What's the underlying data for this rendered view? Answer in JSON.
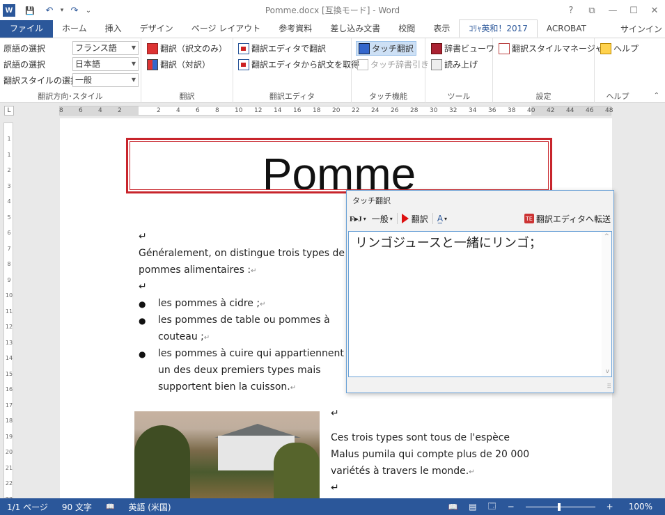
{
  "window": {
    "title": "Pomme.docx [互換モード] - Word",
    "signin": "サインイン",
    "ctl_help": "?",
    "ctl_restore_small": "⧉",
    "ctl_minimize": "—",
    "ctl_maximize": "☐",
    "ctl_close": "✕"
  },
  "qat": {
    "word_logo": "W",
    "save_glyph": "💾",
    "undo_glyph": "↶",
    "undo_dd": "▾",
    "redo_glyph": "↷",
    "customize": "⌄"
  },
  "tabs": [
    "ファイル",
    "ホーム",
    "挿入",
    "デザイン",
    "ページ レイアウト",
    "参考資料",
    "差し込み文書",
    "校閲",
    "表示",
    "ｺﾘｬ英和！2017",
    "ACROBAT"
  ],
  "ribbon": {
    "direction": {
      "src_label": "原語の選択",
      "src_value": "フランス語",
      "dst_label": "訳語の選択",
      "dst_value": "日本語",
      "style_label": "翻訳スタイルの選択",
      "style_value": "一般",
      "group": "翻訳方向･スタイル"
    },
    "translate": {
      "only": "翻訳（訳文のみ）",
      "paired": "翻訳（対訳）",
      "group": "翻訳"
    },
    "editor": {
      "open": "翻訳エディタで翻訳",
      "fetch": "翻訳エディタから訳文を取得",
      "group": "翻訳エディタ"
    },
    "touch": {
      "translate": "タッチ翻訳",
      "dict": "タッチ辞書引き",
      "group": "タッチ機能"
    },
    "tools": {
      "viewer": "辞書ビューワ",
      "read": "読み上げ",
      "group": "ツール"
    },
    "settings": {
      "manager": "翻訳スタイルマネージャ",
      "group": "設定"
    },
    "help": {
      "label": "ヘルプ",
      "group": "ヘルプ"
    },
    "collapse": "⌃"
  },
  "ruler": {
    "corner": "L",
    "ticks": [
      "8",
      "6",
      "4",
      "2",
      "2",
      "4",
      "6",
      "8",
      "10",
      "12",
      "14",
      "16",
      "18",
      "20",
      "22",
      "24",
      "26",
      "28",
      "30",
      "32",
      "34",
      "36",
      "38",
      "40",
      "42",
      "44",
      "46",
      "48"
    ],
    "vticks": [
      "1",
      "1",
      "2",
      "3",
      "4",
      "5",
      "6",
      "7",
      "8",
      "9",
      "10",
      "11",
      "12",
      "13",
      "14",
      "15",
      "16",
      "17",
      "18",
      "19",
      "20",
      "21",
      "22",
      "23"
    ]
  },
  "document": {
    "title": "Pomme",
    "pilcrow": "↵",
    "para1_line1": "Généralement, on distingue trois types de",
    "para1_line2": "pommes alimentaires :",
    "bullet_glyph": "●",
    "bullets": [
      "les pommes à cidre ;",
      "les pommes de table ou pommes à",
      "couteau ;",
      "les pommes à cuire qui appartiennent à",
      "un des deux premiers types mais",
      "supportent bien la cuisson."
    ],
    "para2_line1": " Ces trois types sont tous de l'espèce",
    "para2_line2": "Malus pumila qui compte plus de 20 000",
    "para2_line3": "variétés à travers le monde."
  },
  "touch_panel": {
    "title": "タッチ翻訳",
    "fj": "F▸J",
    "dropdown": "▾",
    "style": "一般",
    "translate": "翻訳",
    "aa_glyph": "A̲",
    "send_icon_text": "TE",
    "send": "翻訳エディタへ転送",
    "result": "リンゴジュースと一緒にリンゴ；",
    "scroll_up": "^",
    "scroll_down": "v",
    "grip": "⠿"
  },
  "status": {
    "page": "1/1 ページ",
    "words": "90 文字",
    "proof_glyph": "📖",
    "language": "英語 (米国)",
    "view_read": "📖",
    "view_print": "▤",
    "view_web": "🗔",
    "zoom_minus": "−",
    "zoom_plus": "+",
    "zoom": "100%",
    "zoom_level": 1.0
  }
}
